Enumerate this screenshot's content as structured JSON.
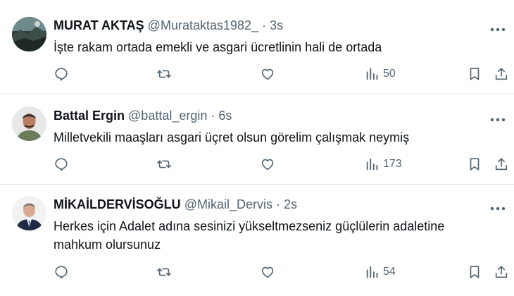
{
  "colors": {
    "text": "#0f1419",
    "muted": "#536471",
    "divider": "#e1e6ea",
    "background": "#ffffff"
  },
  "tweets": [
    {
      "name": "MURAT AKTAŞ",
      "handle": "@Murataktas1982_",
      "dot": "·",
      "time": "3s",
      "text": "İşte rakam ortada emekli ve asgari ücretlinin hali de ortada",
      "views": "50",
      "avatar_icon": "landscape-avatar"
    },
    {
      "name": "Battal Ergin",
      "handle": "@battal_ergin",
      "dot": "·",
      "time": "6s",
      "text": "Milletvekili maaşları asgari üçret olsun görelim çalışmak neymiş",
      "views": "173",
      "avatar_icon": "person-avatar"
    },
    {
      "name": "MİKAİLDERVİSOĞLU",
      "handle": "@Mikail_Dervis",
      "dot": "·",
      "time": "2s",
      "text": "Herkes için Adalet adına sesinizi yükseltmezseniz güçlülerin adaletine mahkum olursunuz",
      "views": "54",
      "avatar_icon": "person-suit-avatar"
    }
  ],
  "icons": {
    "more": "more-icon",
    "reply": "reply-icon",
    "retweet": "retweet-icon",
    "like": "like-icon",
    "views": "views-icon",
    "bookmark": "bookmark-icon",
    "share": "share-icon"
  }
}
